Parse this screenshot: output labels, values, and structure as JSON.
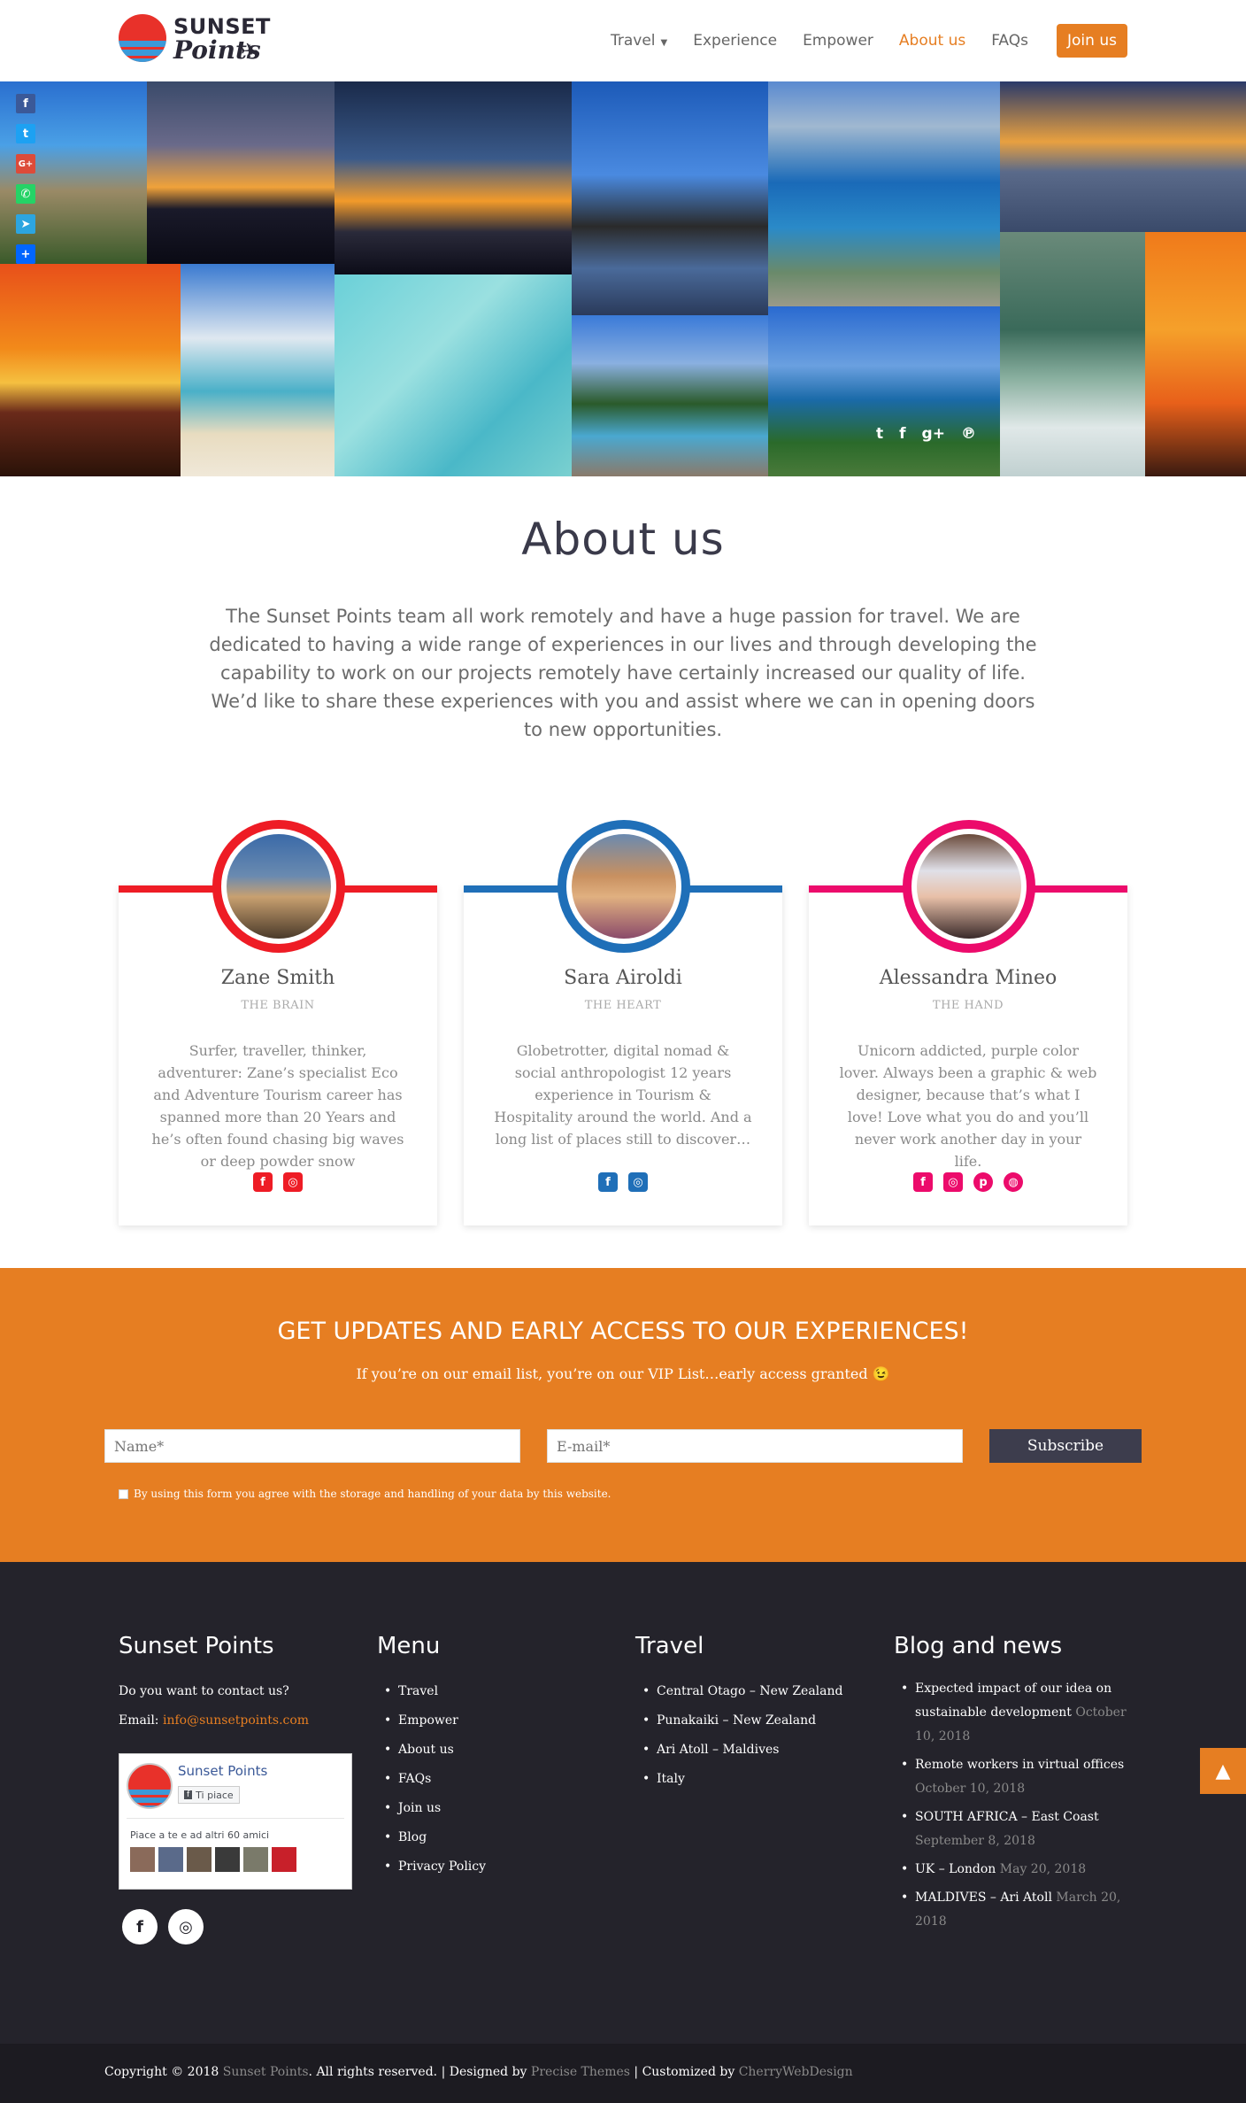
{
  "brand": {
    "line1": "SUNSET",
    "line2": "Points"
  },
  "nav": {
    "items": [
      {
        "label": "Travel",
        "active": false
      },
      {
        "label": "Experience",
        "active": false
      },
      {
        "label": "Empower",
        "active": false
      },
      {
        "label": "About us",
        "active": true
      },
      {
        "label": "FAQs",
        "active": false
      }
    ],
    "join_label": "Join us"
  },
  "share_bar": [
    "facebook-icon",
    "twitter-icon",
    "google-plus-icon",
    "whatsapp-icon",
    "telegram-icon",
    "share-plus-icon"
  ],
  "gallery_social": [
    "twitter-icon",
    "facebook-icon",
    "google-plus-icon",
    "pinterest-icon"
  ],
  "about": {
    "title": "About us",
    "paragraph1": "The Sunset Points team all work remotely and have a huge passion for travel. We are dedicated to having a wide range of experiences in our lives and through developing the capability to work on our projects remotely have certainly increased our quality of life.",
    "paragraph2": "We’d like to share these experiences with you and assist where we can in opening doors to new opportunities."
  },
  "team": [
    {
      "name": "Zane Smith",
      "role": "THE BRAIN",
      "color": "#ee1c25",
      "bio": "Surfer, traveller, thinker, adventurer: Zane’s specialist Eco and Adventure Tourism career has spanned more than 20 Years and he’s often found chasing big waves or deep powder snow",
      "icons": [
        "facebook-icon",
        "instagram-icon"
      ]
    },
    {
      "name": "Sara Airoldi",
      "role": "THE HEART",
      "color": "#1f6fb8",
      "bio": "Globetrotter, digital nomad & social anthropologist 12 years experience in Tourism & Hospitality around the world. And a long list of places still to discover…",
      "icons": [
        "facebook-icon",
        "instagram-icon"
      ]
    },
    {
      "name": "Alessandra Mineo",
      "role": "THE HAND",
      "color": "#ec0b6b",
      "bio": "Unicorn addicted, purple color lover. Always been a graphic & web designer, because that’s what I love! Love what you do and you’ll never work another day in your life.",
      "icons": [
        "facebook-icon",
        "instagram-icon",
        "pinterest-icon",
        "dribbble-icon"
      ]
    }
  ],
  "newsletter": {
    "title": "GET UPDATES AND EARLY ACCESS TO OUR EXPERIENCES!",
    "subtitle": "If you’re on our email list, you’re on our VIP List…early access granted 😉",
    "name_placeholder": "Name*",
    "email_placeholder": "E-mail*",
    "button": "Subscribe",
    "consent": "By using this form you agree with the storage and handling of your data by this website."
  },
  "footer": {
    "col1": {
      "title": "Sunset Points",
      "contact_q": "Do you want to contact us?",
      "email_label": "Email:",
      "email": "info@sunsetpoints.com",
      "fb_page": "Sunset Points",
      "fb_like": "Ti piace",
      "fb_friends": "Piace a te e ad altri 60 amici"
    },
    "col2": {
      "title": "Menu",
      "items": [
        "Travel",
        "Empower",
        "About us",
        "FAQs",
        "Join us",
        "Blog",
        "Privacy Policy"
      ]
    },
    "col3": {
      "title": "Travel",
      "items": [
        "Central Otago – New Zealand",
        "Punakaiki – New Zealand",
        "Ari Atoll – Maldives",
        "Italy"
      ]
    },
    "col4": {
      "title": "Blog and news",
      "items": [
        {
          "title": "Expected impact of our idea on sustainable development",
          "date": "October 10, 2018"
        },
        {
          "title": "Remote workers in virtual offices",
          "date": "October 10, 2018"
        },
        {
          "title": "SOUTH AFRICA – East Coast",
          "date": "September 8, 2018"
        },
        {
          "title": "UK – London",
          "date": "May 20, 2018"
        },
        {
          "title": "MALDIVES – Ari Atoll",
          "date": "March 20, 2018"
        }
      ]
    }
  },
  "copyright": {
    "prefix": "Copyright © 2018",
    "brand": "Sunset Points",
    "rights": ". All rights reserved. | Designed by",
    "designer": "Precise Themes",
    "customized": "| Customized by",
    "customizer": "CherryWebDesign"
  }
}
